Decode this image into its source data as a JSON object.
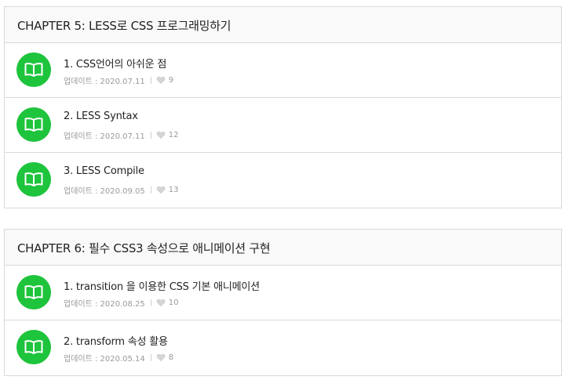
{
  "colors": {
    "accent": "#1ec43c",
    "border": "#d9d9d9",
    "header_bg": "#f9f9f9",
    "meta_text": "#9a9a9a"
  },
  "chapters": [
    {
      "title": "CHAPTER 5: LESS로 CSS 프로그래밍하기",
      "lessons": [
        {
          "title": "1. CSS언어의 아쉬운 점",
          "updated": "업데이트 : 2020.07.11",
          "likes": "9",
          "icon": "book-icon"
        },
        {
          "title": "2. LESS Syntax",
          "updated": "업데이트 : 2020.07.11",
          "likes": "12",
          "icon": "book-icon"
        },
        {
          "title": "3. LESS Compile",
          "updated": "업데이트 : 2020.09.05",
          "likes": "13",
          "icon": "book-icon"
        }
      ]
    },
    {
      "title": "CHAPTER 6: 필수 CSS3 속성으로 애니메이션 구현",
      "lessons": [
        {
          "title": "1. transition 을 이용한 CSS 기본 애니메이션",
          "updated": "업데이트 : 2020.08.25",
          "likes": "10",
          "icon": "book-icon"
        },
        {
          "title": "2. transform 속성 활용",
          "updated": "업데이트 : 2020.05.14",
          "likes": "8",
          "icon": "book-icon"
        }
      ]
    }
  ]
}
